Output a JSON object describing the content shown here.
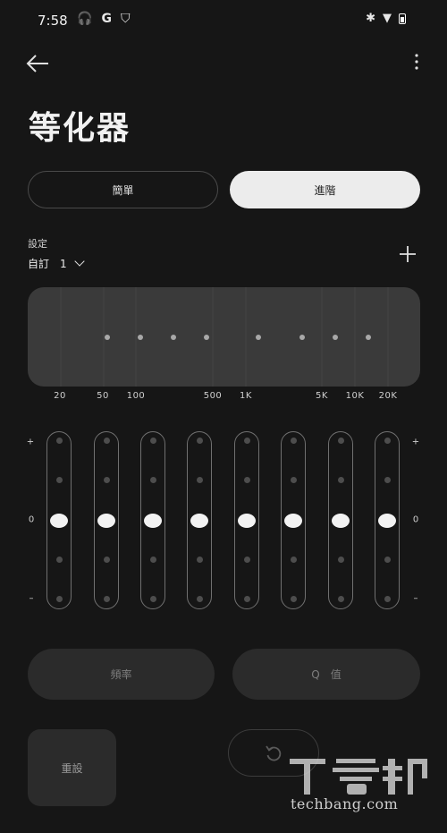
{
  "status_bar": {
    "time": "7:58",
    "left_icons": [
      "headphones-icon",
      "google-icon",
      "shield-icon"
    ],
    "right_icons": [
      "bluetooth-icon",
      "wifi-icon",
      "battery-icon"
    ],
    "glyphs": {
      "headphones": "🎧",
      "google": "G",
      "shield": "⛉",
      "bluetooth": "✱",
      "wifi": "▼"
    }
  },
  "header": {
    "title": "等化器",
    "back_icon": "arrow-left-icon",
    "menu_icon": "more-vertical-icon"
  },
  "mode_tabs": [
    {
      "label": "簡單",
      "selected": false
    },
    {
      "label": "進階",
      "selected": true
    }
  ],
  "preset": {
    "label": "設定",
    "value": "自訂　1",
    "add_icon": "plus-icon"
  },
  "frequency_labels": [
    "20",
    "50",
    "100",
    "500",
    "1K",
    "5K",
    "10K",
    "20K"
  ],
  "gain_scale": {
    "plus": "+",
    "zero": "0",
    "minus": "–"
  },
  "bands": [
    {
      "gain": 0
    },
    {
      "gain": 0
    },
    {
      "gain": 0
    },
    {
      "gain": 0
    },
    {
      "gain": 0
    },
    {
      "gain": 0
    },
    {
      "gain": 0
    },
    {
      "gain": 0
    }
  ],
  "params": {
    "frequency_label": "頻率",
    "q_label": "Q　值"
  },
  "actions": {
    "reset_label": "重設",
    "undo_icon": "undo-icon"
  },
  "watermark": {
    "logo": "T客邦",
    "text": "techbang.com"
  },
  "colors": {
    "background": "#161616",
    "panel": "#3a3a3a",
    "button": "#2b2b2b",
    "selected_tab": "#ececec",
    "thumb": "#f2f2f2"
  }
}
